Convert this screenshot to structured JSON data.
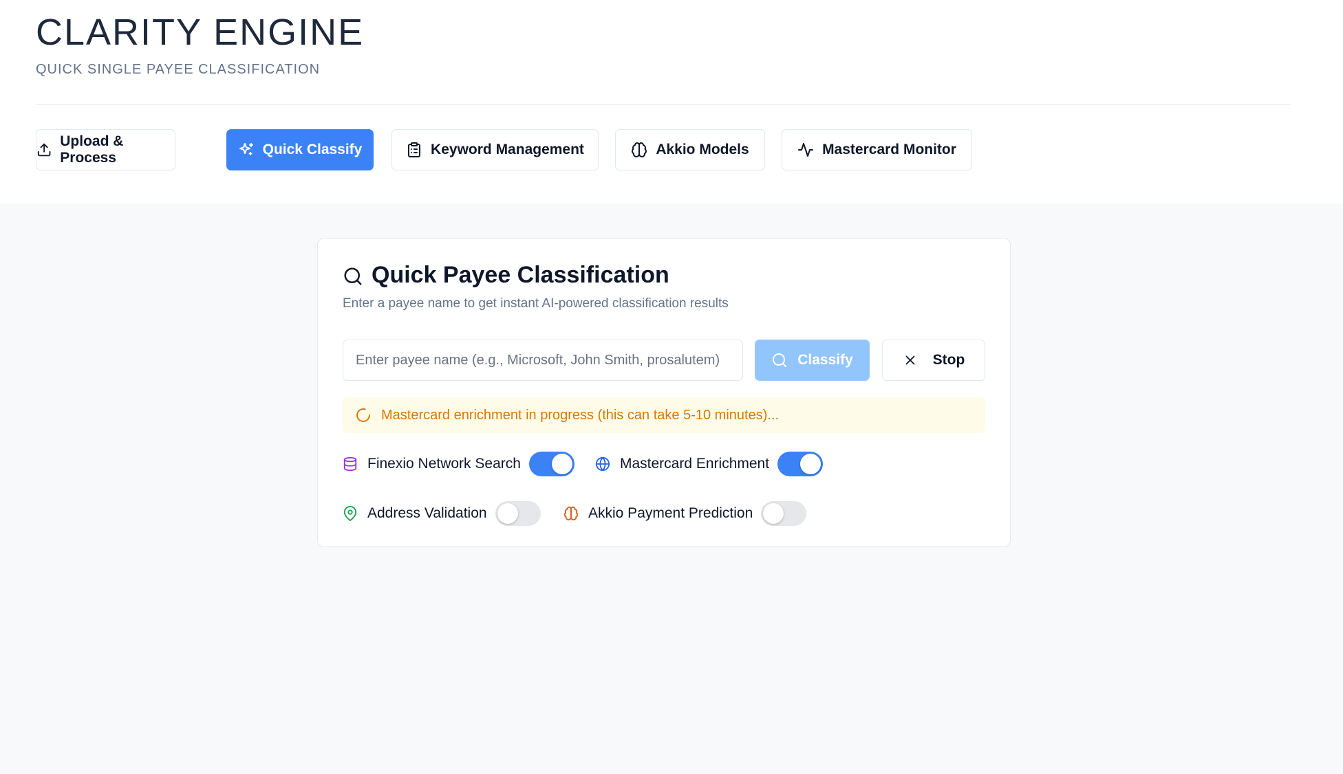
{
  "header": {
    "title": "CLARITY ENGINE",
    "subtitle": "QUICK SINGLE PAYEE CLASSIFICATION"
  },
  "nav": {
    "tabs": [
      {
        "label": "Upload & Process",
        "icon": "upload-icon",
        "active": false
      },
      {
        "label": "Quick Classify",
        "icon": "sparkles-icon",
        "active": true
      },
      {
        "label": "Keyword Management",
        "icon": "clipboard-list-icon",
        "active": false
      },
      {
        "label": "Akkio Models",
        "icon": "brain-icon",
        "active": false
      },
      {
        "label": "Mastercard Monitor",
        "icon": "activity-icon",
        "active": false
      }
    ]
  },
  "card": {
    "title": "Quick Payee Classification",
    "description": "Enter a payee name to get instant AI-powered classification results",
    "input": {
      "value": "",
      "placeholder": "Enter payee name (e.g., Microsoft, John Smith, prosalutem)"
    },
    "classify_label": "Classify",
    "stop_label": "Stop",
    "status": "Mastercard enrichment in progress (this can take 5-10 minutes)...",
    "options": [
      {
        "label": "Finexio Network Search",
        "icon": "database-icon",
        "enabled": true
      },
      {
        "label": "Mastercard Enrichment",
        "icon": "globe-icon",
        "enabled": true
      },
      {
        "label": "Address Validation",
        "icon": "map-pin-icon",
        "enabled": false
      },
      {
        "label": "Akkio Payment Prediction",
        "icon": "brain-icon",
        "enabled": false
      }
    ]
  },
  "colors": {
    "accent": "#3b82f6",
    "accent_disabled": "#93c5fd",
    "warning_text": "#d97706",
    "warning_bg": "#fefce8",
    "database_icon": "#9333ea",
    "globe_icon": "#2563eb",
    "map_pin_icon": "#16a34a",
    "brain_icon": "#ea580c"
  }
}
